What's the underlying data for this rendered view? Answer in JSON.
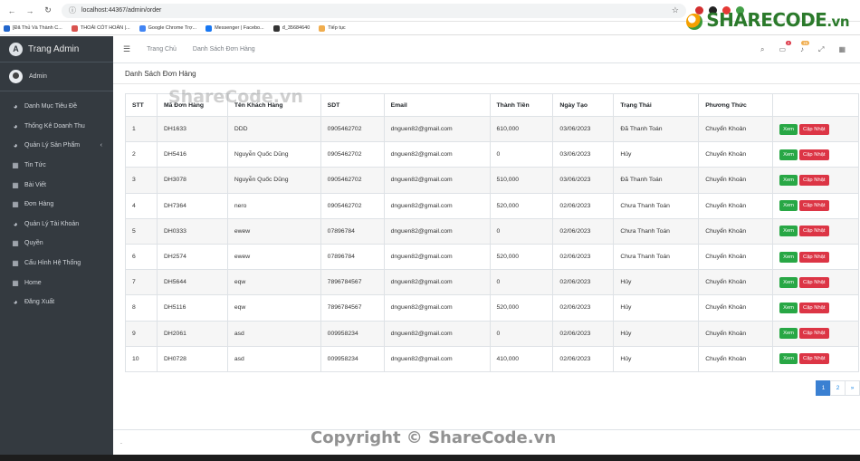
{
  "browser": {
    "url": "localhost:44367/admin/order",
    "bookmarks": [
      {
        "label": "[Đã Thủ Và Thành C...",
        "color": "#2266cc"
      },
      {
        "label": "THOẢI CÓT HOÀN |...",
        "color": "#d9534f"
      },
      {
        "label": "Google Chrome Trợ...",
        "color": "#4285f4"
      },
      {
        "label": "Messenger | Facebo...",
        "color": "#1877f2"
      },
      {
        "label": "đ_35684640",
        "color": "#333333"
      },
      {
        "label": "Tiếp tục",
        "color": "#f0ad4e"
      }
    ]
  },
  "logo": {
    "text": "SHARECODE",
    "suffix": ".vn"
  },
  "sidebar": {
    "brand": "Trang Admin",
    "user": "Admin",
    "items": [
      {
        "label": "Danh Mục Tiêu Đề",
        "icon": "palette-icon"
      },
      {
        "label": "Thống Kê Doanh Thu",
        "icon": "palette-icon"
      },
      {
        "label": "Quản Lý Sản Phẩm",
        "icon": "palette-icon",
        "arrow": "‹"
      },
      {
        "label": "Tin Tức",
        "icon": "grid-icon"
      },
      {
        "label": "Bài Viết",
        "icon": "grid-icon"
      },
      {
        "label": "Đơn Hàng",
        "icon": "grid-icon"
      },
      {
        "label": "Quản Lý Tài Khoản",
        "icon": "palette-icon"
      },
      {
        "label": "Quyền",
        "icon": "grid-icon"
      },
      {
        "label": "Cấu Hình Hệ Thống",
        "icon": "grid-icon"
      },
      {
        "label": "Home",
        "icon": "grid-icon"
      },
      {
        "label": "Đăng Xuất",
        "icon": "palette-icon"
      }
    ]
  },
  "navbar": {
    "home": "Trang Chủ",
    "orders": "Danh Sách Đơn Hàng",
    "messages_badge": "3",
    "notifications_badge": "15"
  },
  "page": {
    "title": "Danh Sách Đơn Hàng",
    "columns": [
      "STT",
      "Mã Đơn Hàng",
      "Tên Khách Hàng",
      "SDT",
      "Email",
      "Thành Tiền",
      "Ngày Tạo",
      "Trạng Thái",
      "Phương Thức",
      ""
    ],
    "view_label": "Xem",
    "update_label": "Cập Nhật",
    "rows": [
      [
        "1",
        "DH1633",
        "DDD",
        "0905462702",
        "dnguen82@gmail.com",
        "610,000",
        "03/06/2023",
        "Đã Thanh Toán",
        "Chuyển Khoản"
      ],
      [
        "2",
        "DH5416",
        "Nguyễn Quốc Dũng",
        "0905462702",
        "dnguen82@gmail.com",
        "0",
        "03/06/2023",
        "Hủy",
        "Chuyển Khoản"
      ],
      [
        "3",
        "DH3078",
        "Nguyễn Quốc Dũng",
        "0905462702",
        "dnguen82@gmail.com",
        "510,000",
        "03/06/2023",
        "Đã Thanh Toán",
        "Chuyển Khoản"
      ],
      [
        "4",
        "DH7364",
        "nero",
        "0905462702",
        "dnguen82@gmail.com",
        "520,000",
        "02/06/2023",
        "Chưa Thanh Toán",
        "Chuyển Khoản"
      ],
      [
        "5",
        "DH0333",
        "ewew",
        "07896784",
        "dnguen82@gmail.com",
        "0",
        "02/06/2023",
        "Chưa Thanh Toán",
        "Chuyển Khoản"
      ],
      [
        "6",
        "DH2574",
        "ewew",
        "07896784",
        "dnguen82@gmail.com",
        "520,000",
        "02/06/2023",
        "Chưa Thanh Toán",
        "Chuyển Khoản"
      ],
      [
        "7",
        "DH5644",
        "eqw",
        "7896784567",
        "dnguen82@gmail.com",
        "0",
        "02/06/2023",
        "Hủy",
        "Chuyển Khoản"
      ],
      [
        "8",
        "DH5116",
        "eqw",
        "7896784567",
        "dnguen82@gmail.com",
        "520,000",
        "02/06/2023",
        "Hủy",
        "Chuyển Khoản"
      ],
      [
        "9",
        "DH2061",
        "asd",
        "009958234",
        "dnguen82@gmail.com",
        "0",
        "02/06/2023",
        "Hủy",
        "Chuyển Khoản"
      ],
      [
        "10",
        "DH0728",
        "asd",
        "009958234",
        "dnguen82@gmail.com",
        "410,000",
        "02/06/2023",
        "Hủy",
        "Chuyển Khoản"
      ]
    ],
    "pagination": [
      "1",
      "2",
      "»"
    ],
    "active_page": "1"
  },
  "footer": {
    "text": "."
  },
  "watermarks": {
    "top": "ShareCode.vn",
    "bottom": "Copyright © ShareCode.vn"
  }
}
